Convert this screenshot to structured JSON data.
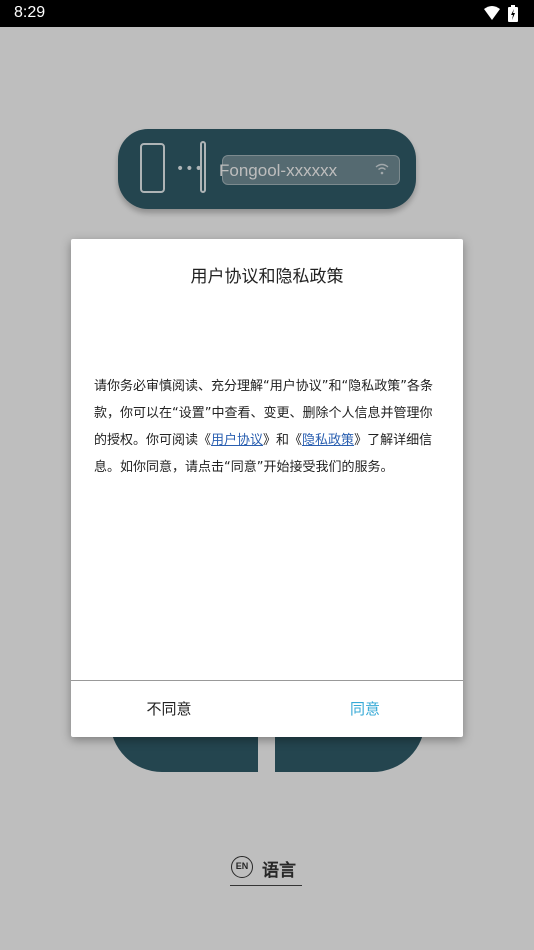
{
  "status_bar": {
    "time": "8:29"
  },
  "device_card": {
    "device_name": "Fongool-xxxxxx",
    "dots": "•••"
  },
  "language": {
    "badge": "EN",
    "label": "语言"
  },
  "dialog": {
    "title": "用户协议和隐私政策",
    "body_1": "请你务必审慎阅读、充分理解“用户协议”和“隐私政策”各条款，你可以在“设置”中查看、变更、删除个人信息并管理你的授权。你可阅读《",
    "user_agreement_link": "用户协议",
    "body_2": "》和《",
    "privacy_policy_link": "隐私政策",
    "body_3": "》了解详细信息。如你同意，请点击“同意”开始接受我们的服务。",
    "disagree_label": "不同意",
    "agree_label": "同意"
  },
  "colors": {
    "agree": "#35a9d6",
    "link": "#2a5fb0",
    "card": "#2f5966"
  }
}
